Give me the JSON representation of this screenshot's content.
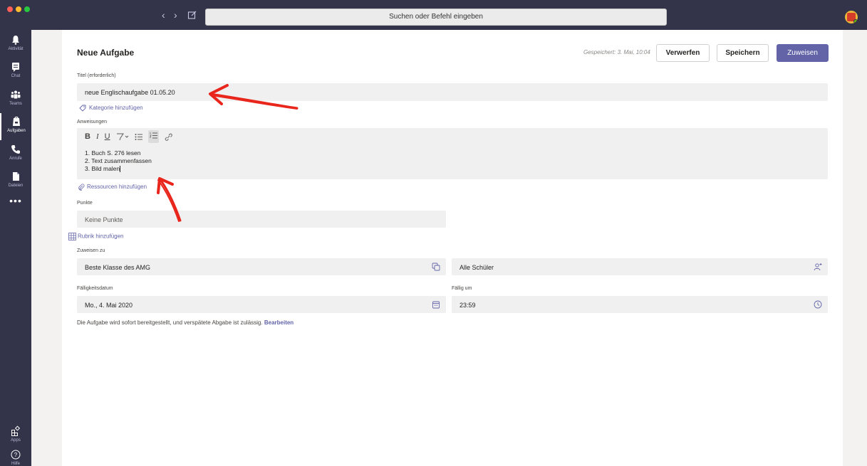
{
  "search": {
    "placeholder": "Suchen oder Befehl eingeben"
  },
  "rail": {
    "items": [
      {
        "label": "Aktivität",
        "icon": "bell-icon"
      },
      {
        "label": "Chat",
        "icon": "chat-icon"
      },
      {
        "label": "Teams",
        "icon": "teams-icon"
      },
      {
        "label": "Aufgaben",
        "icon": "assignments-icon"
      },
      {
        "label": "Anrufe",
        "icon": "phone-icon"
      },
      {
        "label": "Dateien",
        "icon": "files-icon"
      }
    ],
    "more": "•••",
    "apps_label": "Apps",
    "help_label": "Hilfe"
  },
  "header": {
    "title": "Neue Aufgabe",
    "saved": "Gespeichert: 3. Mai, 10:04",
    "discard": "Verwerfen",
    "save": "Speichern",
    "assign": "Zuweisen"
  },
  "form": {
    "title_label": "Titel (erforderlich)",
    "title_value": "neue Englischaufgabe 01.05.20",
    "add_category": "Kategorie hinzufügen",
    "instructions_label": "Anweisungen",
    "instructions": [
      "1. Buch S. 276 lesen",
      "2. Text zusammenfassen",
      "3. Bild malen"
    ],
    "add_resources": "Ressourcen hinzufügen",
    "points_label": "Punkte",
    "points_placeholder": "Keine Punkte",
    "add_rubric": "Rubrik hinzufügen",
    "assign_to_label": "Zuweisen zu",
    "class_value": "Beste Klasse des AMG",
    "students_value": "Alle Schüler",
    "due_date_label": "Fälligkeitsdatum",
    "due_date_value": "Mo., 4. Mai 2020",
    "due_time_label": "Fällig um",
    "due_time_value": "23:59",
    "note": "Die Aufgabe wird sofort bereitgestellt, und verspätete Abgabe ist zulässig.",
    "note_edit": "Bearbeiten"
  },
  "colors": {
    "rail": "#33344a",
    "accent": "#6264a7",
    "annotation": "#e8261c"
  }
}
